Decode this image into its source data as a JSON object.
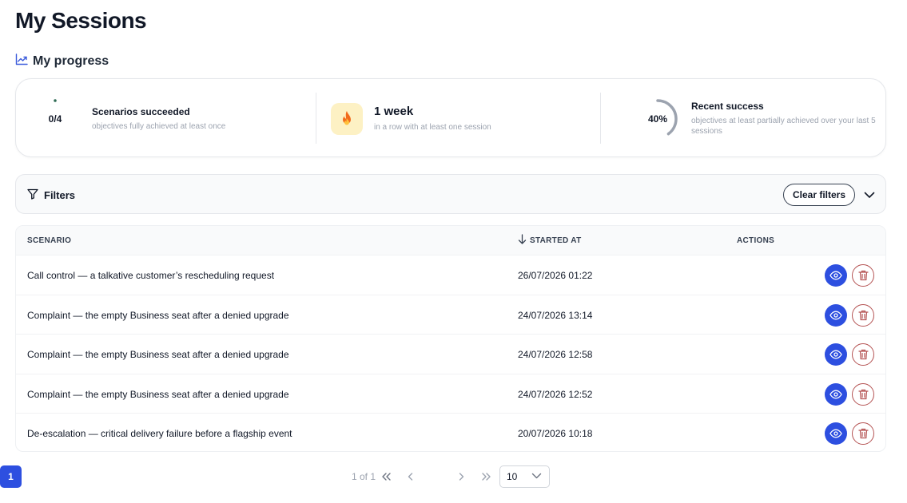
{
  "page": {
    "title": "My Sessions"
  },
  "progress": {
    "heading": "My progress",
    "heading_icon": "trending-up-icon",
    "scenarios": {
      "value_label": "0/4",
      "fraction": 0,
      "title": "Scenarios succeeded",
      "subtitle": "objectives fully achieved at least once",
      "ring_color": "#2f6b55"
    },
    "streak": {
      "icon": "flame-icon",
      "title": "1 week",
      "subtitle": "in a row with at least one session"
    },
    "recent": {
      "value_label": "40%",
      "fraction": 0.4,
      "title": "Recent success",
      "subtitle": "objectives at least partially achieved over your last 5 sessions",
      "ring_color": "#9ca3af"
    }
  },
  "filters": {
    "label": "Filters",
    "icon": "filter-icon",
    "clear_label": "Clear filters",
    "collapse_icon": "chevron-down-icon"
  },
  "table": {
    "columns": {
      "scenario": "SCENARIO",
      "started_at": "STARTED AT",
      "actions": "ACTIONS"
    },
    "sort_icon": "arrow-down-icon",
    "rows": [
      {
        "scenario": "Call control — a talkative customer’s rescheduling request",
        "started_at": "26/07/2026 01:22"
      },
      {
        "scenario": "Complaint — the empty Business seat after a denied upgrade",
        "started_at": "24/07/2026 13:14"
      },
      {
        "scenario": "Complaint — the empty Business seat after a denied upgrade",
        "started_at": "24/07/2026 12:58"
      },
      {
        "scenario": "Complaint — the empty Business seat after a denied upgrade",
        "started_at": "24/07/2026 12:52"
      },
      {
        "scenario": "De-escalation — critical delivery failure before a flagship event",
        "started_at": "20/07/2026 10:18"
      }
    ],
    "view_icon": "eye-icon",
    "delete_icon": "trash-icon"
  },
  "pagination": {
    "info": "1 of 1",
    "current_page": "1",
    "page_size": "10"
  },
  "colors": {
    "accent": "#2d4fe0",
    "danger": "#b45252",
    "flame_bg": "#fdf1c4"
  }
}
